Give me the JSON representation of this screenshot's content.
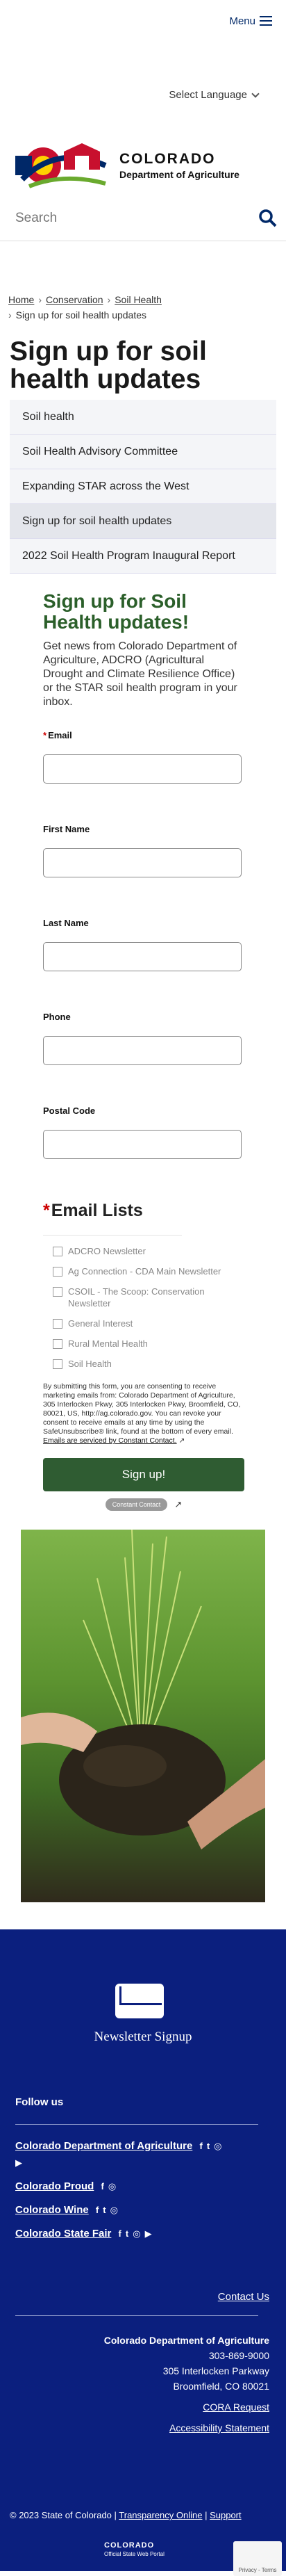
{
  "header": {
    "menu_label": "Menu",
    "language_label": "Select Language",
    "logo_title": "COLORADO",
    "logo_subtitle": "Department of Agriculture",
    "search_placeholder": "Search"
  },
  "breadcrumbs": [
    "Home",
    "Conservation",
    "Soil Health",
    "Sign up for soil health updates"
  ],
  "page_title": "Sign up for soil health updates",
  "subnav": [
    {
      "label": "Soil health",
      "active": false
    },
    {
      "label": "Soil Health Advisory Committee",
      "active": false
    },
    {
      "label": "Expanding STAR across the West",
      "active": false
    },
    {
      "label": "Sign up for soil health updates",
      "active": true
    },
    {
      "label": "2022 Soil Health Program Inaugural Report",
      "active": false
    }
  ],
  "form": {
    "title": "Sign up for Soil Health updates!",
    "intro": "Get news from Colorado Department of Agriculture, ADCRO (Agricultural Drought and Climate Resilience Office) or the STAR soil health program in your inbox.",
    "fields": [
      {
        "label": "Email",
        "required": true
      },
      {
        "label": "First Name",
        "required": false
      },
      {
        "label": "Last Name",
        "required": false
      },
      {
        "label": "Phone",
        "required": false
      },
      {
        "label": "Postal Code",
        "required": false
      }
    ],
    "lists_title": "Email Lists",
    "lists": [
      "ADCRO Newsletter",
      "Ag Connection - CDA Main Newsletter",
      "CSOIL - The Scoop: Conservation Newsletter",
      "General Interest",
      "Rural Mental Health",
      "Soil Health"
    ],
    "consent": "By submitting this form, you are consenting to receive marketing emails from: Colorado Department of Agriculture, 305 Interlocken Pkwy, 305 Interlocken Pkwy, Broomfield, CO, 80021, US, http://ag.colorado.gov. You can revoke your consent to receive emails at any time by using the SafeUnsubscribe® link, found at the bottom of every email.",
    "consent_link": "Emails are serviced by Constant Contact.",
    "submit_label": "Sign up!",
    "cc_badge": "Constant Contact"
  },
  "footer": {
    "newsletter_label": "Newsletter Signup",
    "follow_label": "Follow us",
    "social": [
      {
        "label": "Colorado Department of Agriculture",
        "icons": [
          "f",
          "t",
          "ig",
          "yt"
        ]
      },
      {
        "label": "Colorado Proud",
        "icons": [
          "f",
          "ig"
        ]
      },
      {
        "label": "Colorado Wine",
        "icons": [
          "f",
          "t",
          "ig"
        ]
      },
      {
        "label": "Colorado State Fair",
        "icons": [
          "f",
          "t",
          "ig",
          "yt"
        ]
      }
    ],
    "contact_label": "Contact Us",
    "org_name": "Colorado Department of Agriculture",
    "phone": "303-869-9000",
    "street": "305 Interlocken Parkway",
    "city": "Broomfield, CO 80021",
    "cora_label": "CORA Request",
    "accessibility_label": "Accessibility Statement",
    "copyright": "© 2023 State of Colorado",
    "transparency_label": "Transparency Online",
    "support_label": "Support",
    "state_logo_text": "COLORADO",
    "state_logo_sub": "Official State Web Portal",
    "recaptcha_text": "Privacy - Terms"
  },
  "colors": {
    "brand_blue": "#002868",
    "footer_blue": "#0b1f7e",
    "form_green": "#2b5f2a",
    "button_green": "#2f5c32"
  }
}
